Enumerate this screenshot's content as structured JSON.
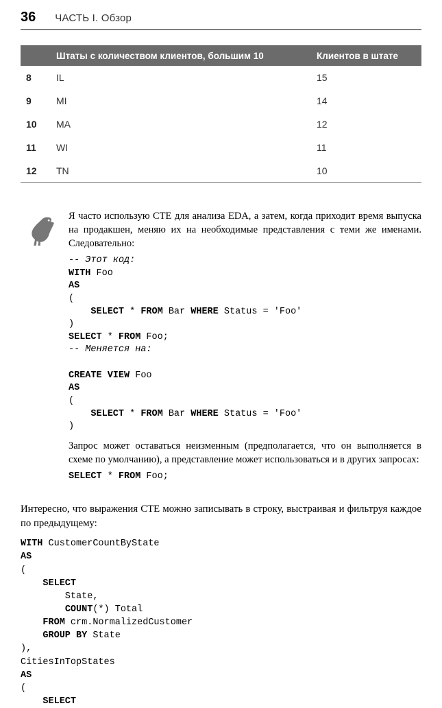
{
  "header": {
    "page_number": "36",
    "part_title": "ЧАСТЬ I. Обзор"
  },
  "chart_data": {
    "type": "table",
    "columns": [
      "",
      "Штаты с количеством клиентов, большим 10",
      "Клиентов в штате"
    ],
    "rows": [
      {
        "idx": "8",
        "state": "IL",
        "count": "15"
      },
      {
        "idx": "9",
        "state": "MI",
        "count": "14"
      },
      {
        "idx": "10",
        "state": "MA",
        "count": "12"
      },
      {
        "idx": "11",
        "state": "WI",
        "count": "11"
      },
      {
        "idx": "12",
        "state": "TN",
        "count": "10"
      }
    ]
  },
  "note": {
    "para1": "Я часто использую CTE для анализа EDA, а затем, когда приходит время выпуска на продакшен, меняю их на необходимые представления с теми же именами. Следовательно:",
    "code1": {
      "c1": "-- Этот код:",
      "l2a": "WITH",
      "l2b": " Foo",
      "l3": "AS",
      "l4": "(",
      "l5a": "    ",
      "l5b": "SELECT",
      "l5c": " * ",
      "l5d": "FROM",
      "l5e": " Bar ",
      "l5f": "WHERE",
      "l5g": " Status = 'Foo'",
      "l6": ")",
      "l7a": "SELECT",
      "l7b": " * ",
      "l7c": "FROM",
      "l7d": " Foo;",
      "c2": "-- Меняется на:",
      "blank": "",
      "l9a": "CREATE VIEW",
      "l9b": " Foo",
      "l10": "AS",
      "l11": "(",
      "l12a": "    ",
      "l12b": "SELECT",
      "l12c": " * ",
      "l12d": "FROM",
      "l12e": " Bar ",
      "l12f": "WHERE",
      "l12g": " Status = 'Foo'",
      "l13": ")"
    },
    "para2": "Запрос может оставаться неизменным (предполагается, что он выполняется в схеме по умолчанию), а представление может использоваться и в других запросах:",
    "code2": {
      "a": "SELECT",
      "b": " * ",
      "c": "FROM",
      "d": " Foo;"
    }
  },
  "body": {
    "para": "Интересно, что выражения CTE можно записывать в строку, выстраивая и фильтруя каждое по предыдущему:"
  },
  "code_main": {
    "l1a": "WITH",
    "l1b": " CustomerCountByState",
    "l2": "AS",
    "l3": "(",
    "l4a": "    ",
    "l4b": "SELECT",
    "l5": "        State,",
    "l6a": "        ",
    "l6b": "COUNT",
    "l6c": "(*) Total",
    "l7a": "    ",
    "l7b": "FROM",
    "l7c": " crm.NormalizedCustomer",
    "l8a": "    ",
    "l8b": "GROUP BY",
    "l8c": " State",
    "l9": "),",
    "l10": "CitiesInTopStates",
    "l11": "AS",
    "l12": "(",
    "l13a": "    ",
    "l13b": "SELECT"
  }
}
